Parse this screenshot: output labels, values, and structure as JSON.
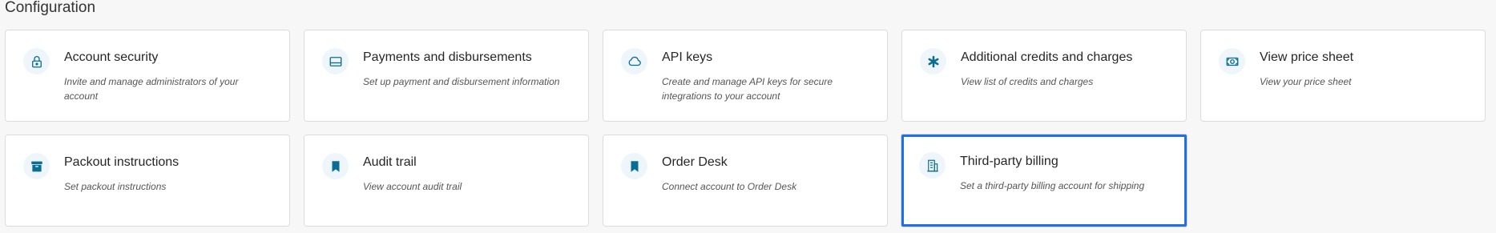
{
  "page": {
    "title": "Configuration"
  },
  "cards": [
    {
      "title": "Account security",
      "description": "Invite and manage administrators of your account",
      "icon": "lock-icon"
    },
    {
      "title": "Payments and disbursements",
      "description": "Set up payment and disbursement information",
      "icon": "credit-card-icon"
    },
    {
      "title": "API keys",
      "description": "Create and manage API keys for secure integrations to your account",
      "icon": "cloud-icon"
    },
    {
      "title": "Additional credits and charges",
      "description": "View list of credits and charges",
      "icon": "asterisk-icon"
    },
    {
      "title": "View price sheet",
      "description": "View your price sheet",
      "icon": "money-icon"
    },
    {
      "title": "Packout instructions",
      "description": "Set packout instructions",
      "icon": "box-icon"
    },
    {
      "title": "Audit trail",
      "description": "View account audit trail",
      "icon": "bookmark-icon"
    },
    {
      "title": "Order Desk",
      "description": "Connect account to Order Desk",
      "icon": "bookmark-icon"
    },
    {
      "title": "Third-party billing",
      "description": "Set a third-party billing account for shipping",
      "icon": "building-icon",
      "selected": true
    }
  ],
  "colors": {
    "icon": "#0a6d94",
    "icon_bg": "#eef6fb",
    "selected_border": "#1f6fe8"
  }
}
